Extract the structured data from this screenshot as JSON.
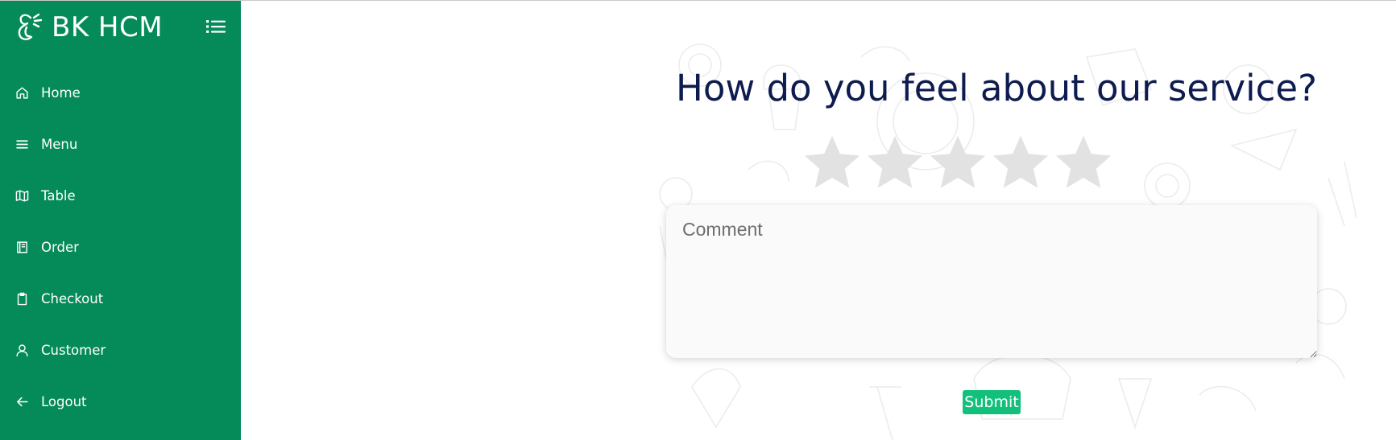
{
  "sidebar": {
    "brand": "BK HCM",
    "brand_logo_icon": "chef-hat-logo-icon",
    "toggle_icon": "list-icon",
    "items": [
      {
        "label": "Home",
        "icon": "home-icon"
      },
      {
        "label": "Menu",
        "icon": "menu-lines-icon"
      },
      {
        "label": "Table",
        "icon": "map-icon"
      },
      {
        "label": "Order",
        "icon": "book-icon"
      },
      {
        "label": "Checkout",
        "icon": "clipboard-icon"
      },
      {
        "label": "Customer",
        "icon": "user-icon"
      },
      {
        "label": "Logout",
        "icon": "arrow-left-icon"
      }
    ]
  },
  "feedback": {
    "title": "How do you feel about our service?",
    "rating": {
      "selected": 0,
      "max": 5
    },
    "comment_placeholder": "Comment",
    "comment_value": "",
    "submit_label": "Submit"
  },
  "colors": {
    "sidebar_bg": "#058b5a",
    "title": "#0d1b4f",
    "star_empty": "#e2e2e2",
    "submit_bg": "#12c07c"
  }
}
